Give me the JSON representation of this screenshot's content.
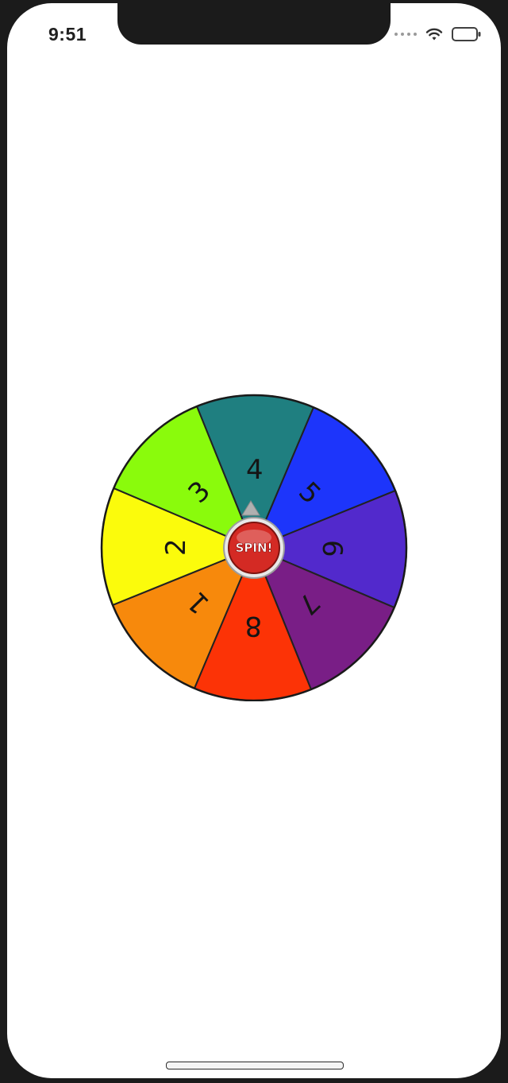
{
  "status_bar": {
    "time": "9:51",
    "wifi_icon": "wifi-icon",
    "battery_icon": "battery-icon"
  },
  "wheel": {
    "segments": [
      {
        "label": "1",
        "color": "#f7890c"
      },
      {
        "label": "2",
        "color": "#fbfb0c"
      },
      {
        "label": "3",
        "color": "#8afb0c"
      },
      {
        "label": "4",
        "color": "#1f7f80"
      },
      {
        "label": "5",
        "color": "#1d35fb"
      },
      {
        "label": "6",
        "color": "#5229cc"
      },
      {
        "label": "7",
        "color": "#791e86"
      },
      {
        "label": "8",
        "color": "#fc3306"
      }
    ],
    "spin_button": {
      "label": "SPIN!",
      "color": "#d42a24"
    }
  }
}
